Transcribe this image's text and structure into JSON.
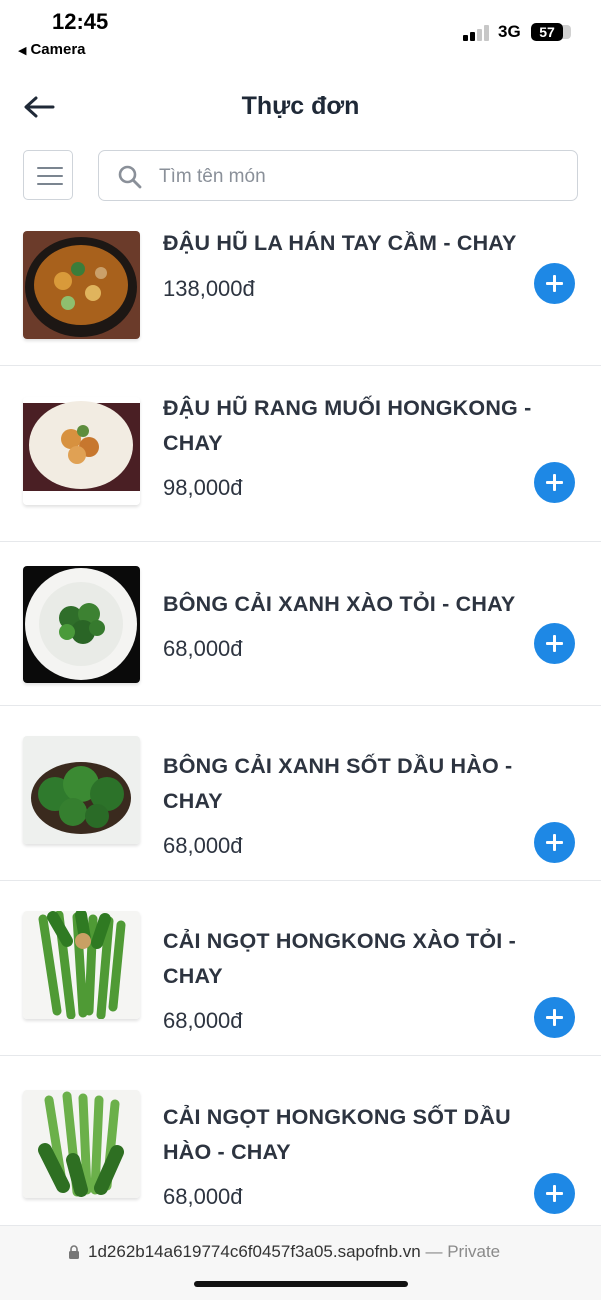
{
  "status_bar": {
    "time": "12:45",
    "back_app": "Camera",
    "network": "3G",
    "battery": "57"
  },
  "header": {
    "title": "Thực đơn",
    "back_icon": "arrow-left-icon"
  },
  "search": {
    "placeholder": "Tìm tên món",
    "value": "",
    "menu_icon": "hamburger-menu-icon"
  },
  "products": [
    {
      "name": "ĐẬU HŨ LA HÁN TAY CẦM - CHAY",
      "price": "138,000đ"
    },
    {
      "name": "ĐẬU HŨ RANG MUỐI HONGKONG - CHAY",
      "price": "98,000đ"
    },
    {
      "name": "BÔNG CẢI XANH XÀO TỎI - CHAY",
      "price": "68,000đ"
    },
    {
      "name": "BÔNG CẢI XANH SỐT DẦU HÀO - CHAY",
      "price": "68,000đ"
    },
    {
      "name": "CẢI NGỌT HONGKONG XÀO TỎI - CHAY",
      "price": "68,000đ"
    },
    {
      "name": "CẢI NGỌT HONGKONG SỐT DẦU HÀO - CHAY",
      "price": "68,000đ"
    }
  ],
  "browser": {
    "url": "1d262b14a619774c6f0457f3a05.sapofnb.vn",
    "mode": "— Private"
  },
  "colors": {
    "accent": "#1e88e5",
    "text": "#2d3440",
    "border": "#cfd4da"
  }
}
